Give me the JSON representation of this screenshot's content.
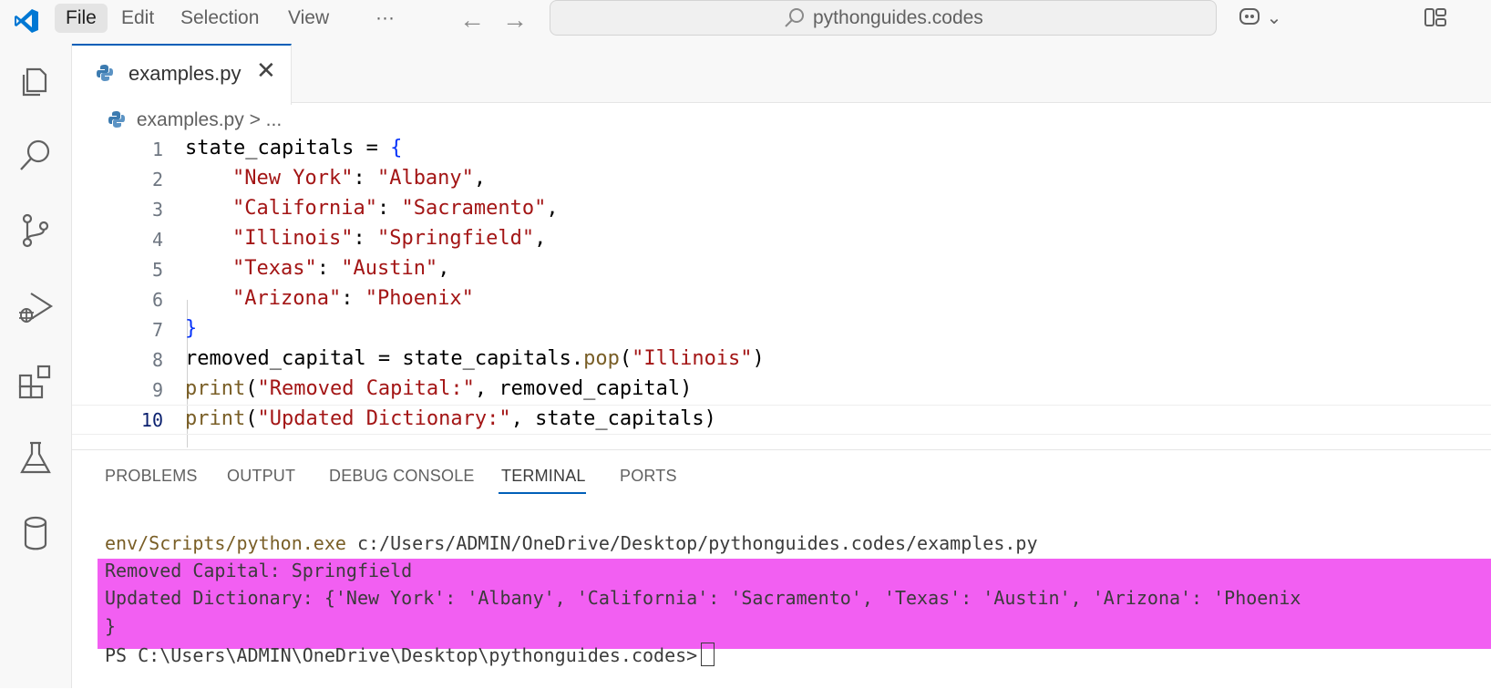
{
  "titlebar": {
    "menus": [
      "File",
      "Edit",
      "Selection",
      "View",
      "···"
    ],
    "search": "pythonguides.codes",
    "copilot": "⌄"
  },
  "activity_bar": [
    "explorer-icon",
    "search-icon",
    "source-control-icon",
    "run-debug-icon",
    "extensions-icon",
    "testing-icon",
    "database-icon"
  ],
  "tab": {
    "label": "examples.py",
    "close": "✕"
  },
  "breadcrumb": {
    "file": "examples.py",
    "rest": " > ..."
  },
  "editor": {
    "current_line": 10,
    "lines": [
      {
        "n": "1"
      },
      {
        "n": "2"
      },
      {
        "n": "3"
      },
      {
        "n": "4"
      },
      {
        "n": "5"
      },
      {
        "n": "6"
      },
      {
        "n": "7"
      },
      {
        "n": "8"
      },
      {
        "n": "9"
      },
      {
        "n": "10"
      }
    ],
    "code": {
      "l1_a": "state_capitals = ",
      "l1_b": "{",
      "l2_k": "\"New York\"",
      "l2_sep": ": ",
      "l2_v": "\"Albany\"",
      "l2_end": ",",
      "l3_k": "\"California\"",
      "l3_sep": ": ",
      "l3_v": "\"Sacramento\"",
      "l3_end": ",",
      "l4_k": "\"Illinois\"",
      "l4_sep": ": ",
      "l4_v": "\"Springfield\"",
      "l4_end": ",",
      "l5_k": "\"Texas\"",
      "l5_sep": ": ",
      "l5_v": "\"Austin\"",
      "l5_end": ",",
      "l6_k": "\"Arizona\"",
      "l6_sep": ": ",
      "l6_v": "\"Phoenix\"",
      "l7": "}",
      "l8_a": "removed_capital = state_capitals.",
      "l8_fn": "pop",
      "l8_p": "(",
      "l8_s": "\"Illinois\"",
      "l8_e": ")",
      "l9_fn": "print",
      "l9_p": "(",
      "l9_s": "\"Removed Capital:\"",
      "l9_e": ", removed_capital)",
      "l10_fn": "print",
      "l10_p": "(",
      "l10_s": "\"Updated Dictionary:\"",
      "l10_e": ", state_capitals)"
    }
  },
  "panel": {
    "tabs": [
      "PROBLEMS",
      "OUTPUT",
      "DEBUG CONSOLE",
      "TERMINAL",
      "PORTS"
    ],
    "active_tab": "TERMINAL"
  },
  "terminal": {
    "cmd_exe": "env/Scripts/python.exe",
    "cmd_arg": " c:/Users/ADMIN/OneDrive/Desktop/pythonguides.codes/examples.py",
    "out1": "Removed Capital: Springfield",
    "out2": "Updated Dictionary: {'New York': 'Albany', 'California': 'Sacramento', 'Texas': 'Austin', 'Arizona': 'Phoenix",
    "out3": "}",
    "prompt": "PS C:\\Users\\ADMIN\\OneDrive\\Desktop\\pythonguides.codes>"
  },
  "colors": {
    "accent": "#005fb8",
    "highlight": "#f25ff2",
    "string": "#a31515",
    "function": "#795e26",
    "exe": "#795e26"
  }
}
